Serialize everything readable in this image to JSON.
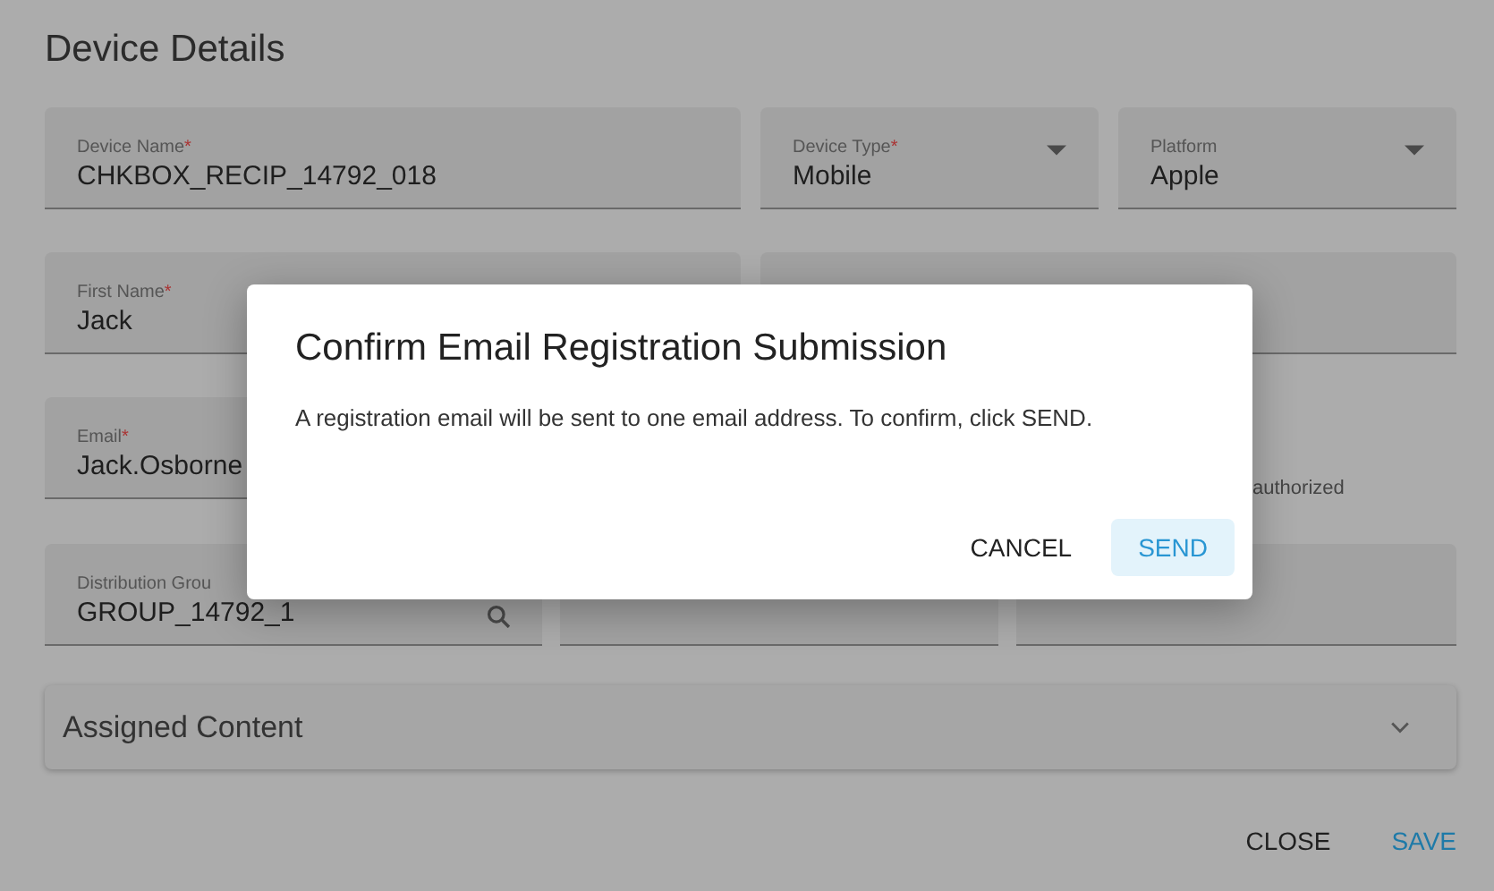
{
  "page": {
    "title": "Device Details"
  },
  "rows": [
    [
      {
        "kind": "text",
        "label": "Device Name",
        "mark": "*",
        "value": "CHKBOX_RECIP_14792_018"
      },
      {
        "kind": "select",
        "label": "Device Type",
        "mark": "*",
        "value": "Mobile"
      },
      {
        "kind": "select",
        "label": "Platform",
        "value": "Apple"
      }
    ],
    [
      {
        "kind": "text",
        "label": "First Name",
        "mark": "*",
        "value": "Jack"
      },
      {
        "kind": "text"
      }
    ],
    [
      {
        "kind": "text",
        "label": "Email",
        "mark": "*",
        "value": "Jack.Osborne"
      },
      {
        "kind": "note",
        "text": "authorized"
      }
    ]
  ],
  "row4": [
    {
      "kind": "search",
      "label": "Distribution Grou",
      "value": "GROUP_14792_1"
    },
    {
      "kind": "text"
    },
    {
      "kind": "text"
    }
  ],
  "panel": {
    "title": "Assigned Content",
    "expanded": false
  },
  "footer": [
    {
      "label": "CLOSE",
      "primary": false
    },
    {
      "label": "SAVE",
      "primary": true
    }
  ],
  "dialog": {
    "title": "Confirm Email Registration Submission",
    "message": "A registration email will be sent to one email address. To confirm, click SEND.",
    "buttons": [
      {
        "label": "CANCEL",
        "primary": false
      },
      {
        "label": "SEND",
        "primary": true
      }
    ]
  }
}
